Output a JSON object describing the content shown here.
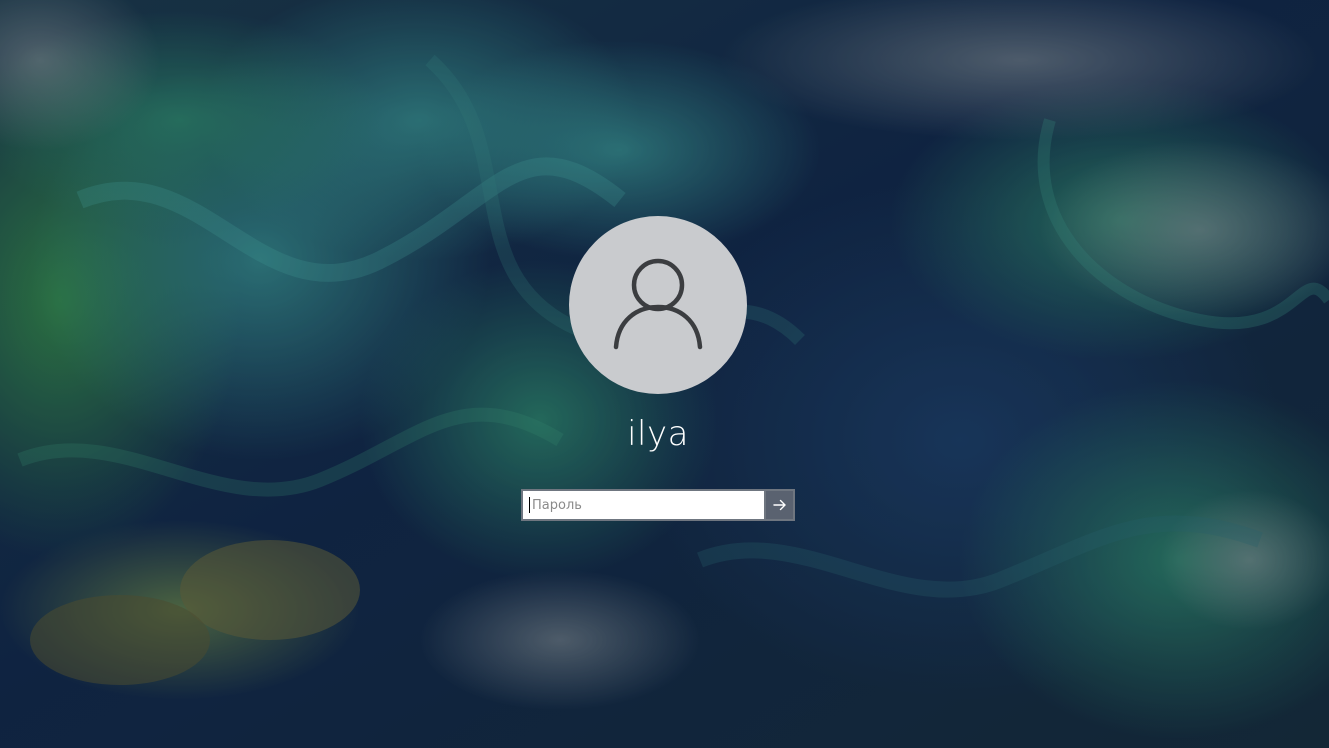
{
  "login": {
    "username": "ilya",
    "password_placeholder": "Пароль",
    "password_value": ""
  },
  "icons": {
    "avatar": "user-silhouette-icon",
    "submit": "arrow-right-icon"
  },
  "colors": {
    "avatar_bg": "#c9cbce",
    "submit_bg": "#5a6270",
    "text": "#ffffff"
  }
}
